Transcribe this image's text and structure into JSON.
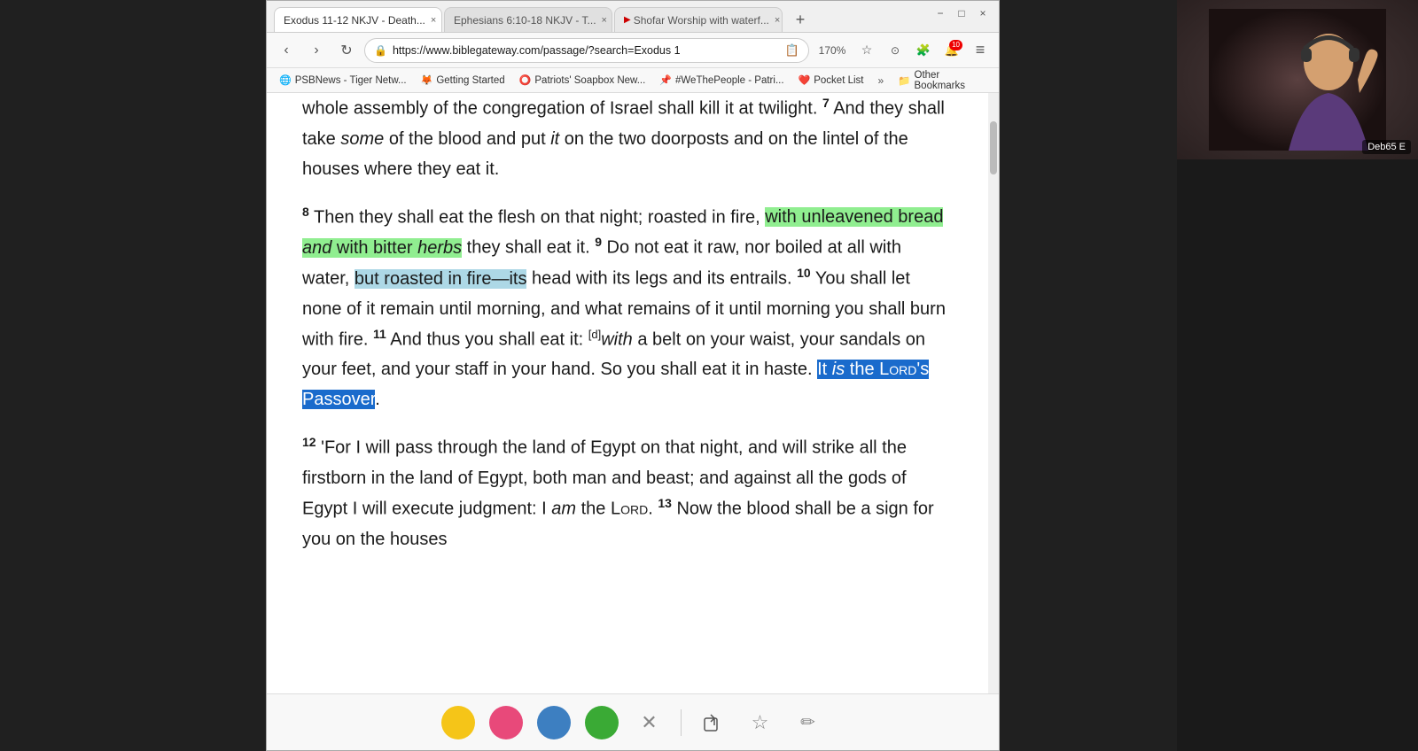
{
  "browser": {
    "tabs": [
      {
        "label": "Exodus 11-12 NKJV - Death...",
        "active": true,
        "close": "×"
      },
      {
        "label": "Ephesians 6:10-18 NKJV - T...",
        "active": false,
        "close": "×"
      },
      {
        "label": "Shofar Worship with waterf...",
        "active": false,
        "close": "×"
      }
    ],
    "new_tab_icon": "+",
    "window_controls": [
      "−",
      "□",
      "×"
    ],
    "nav": {
      "back": "‹",
      "forward": "›",
      "refresh": "↻",
      "lock": "🔒",
      "url": "https://www.biblegateway.com/passage/?search=Exodus 1",
      "zoom": "170%",
      "star": "☆",
      "shield": "⊙",
      "extension": "🧩",
      "notifications_badge": "10",
      "menu": "≡"
    },
    "bookmarks": [
      {
        "icon": "🌐",
        "label": "PSBNews - Tiger Netw..."
      },
      {
        "icon": "🦊",
        "label": "Getting Started"
      },
      {
        "icon": "⭕",
        "label": "Patriots' Soapbox New..."
      },
      {
        "icon": "📌",
        "label": "#WeThePeople - Patri..."
      },
      {
        "icon": "❤️",
        "label": "Pocket List"
      }
    ],
    "more_bookmarks": "»",
    "other_bookmarks_icon": "📁",
    "other_bookmarks_label": "Other Bookmarks"
  },
  "content": {
    "verses": [
      {
        "id": "intro",
        "text": "whole assembly of the congregation of Israel shall kill it at twilight.",
        "partial_top": true
      },
      {
        "verse_num": "7",
        "text": "And they shall take some of the blood and put it on the two doorposts and on the lintel of the houses where they eat it."
      },
      {
        "verse_num": "8",
        "text": "Then they shall eat the flesh on that night; roasted in fire, with unleavened bread and with bitter herbs they shall eat it.",
        "highlights": [
          {
            "text": "with unleavened bread",
            "color": "green"
          },
          {
            "text": "and",
            "italic": true
          },
          {
            "text": "with bitter herbs",
            "color": "green"
          },
          {
            "text": "herbs",
            "italic": true
          }
        ]
      },
      {
        "verse_num": "9",
        "text": "Do not eat it raw, nor boiled at all with water, but roasted in fire—its head with its legs and its entrails.",
        "highlights": [
          {
            "text": "but roasted in fire—its",
            "color": "blue"
          }
        ]
      },
      {
        "verse_num": "10",
        "text": "You shall let none of it remain until morning, and what remains of it until morning you shall burn with fire."
      },
      {
        "verse_num": "11",
        "footnote": "d",
        "text": "And thus you shall eat it: with a belt on your waist, your sandals on your feet, and your staff in your hand. So you shall eat it in haste.",
        "selected": "It is the Lord's Passover",
        "italic_parts": [
          "with",
          "am"
        ]
      },
      {
        "verse_num": "12",
        "text": "'For I will pass through the land of Egypt on that night, and will strike all the firstborn in the land of Egypt, both man and beast; and against all the gods of Egypt I will execute judgment: I am the Lord."
      },
      {
        "verse_num": "13",
        "text": "Now the blood shall be a sign for you on the houses"
      }
    ]
  },
  "toolbar": {
    "colors": [
      {
        "name": "yellow",
        "hex": "#f5c518"
      },
      {
        "name": "pink",
        "hex": "#e8497a"
      },
      {
        "name": "blue",
        "hex": "#3d7fc1"
      },
      {
        "name": "green",
        "hex": "#3aaa35"
      }
    ],
    "clear_btn": "✕",
    "share_btn": "⬜",
    "star_btn": "☆",
    "edit_btn": "✏"
  },
  "webcam": {
    "label": "Deb65 E"
  }
}
